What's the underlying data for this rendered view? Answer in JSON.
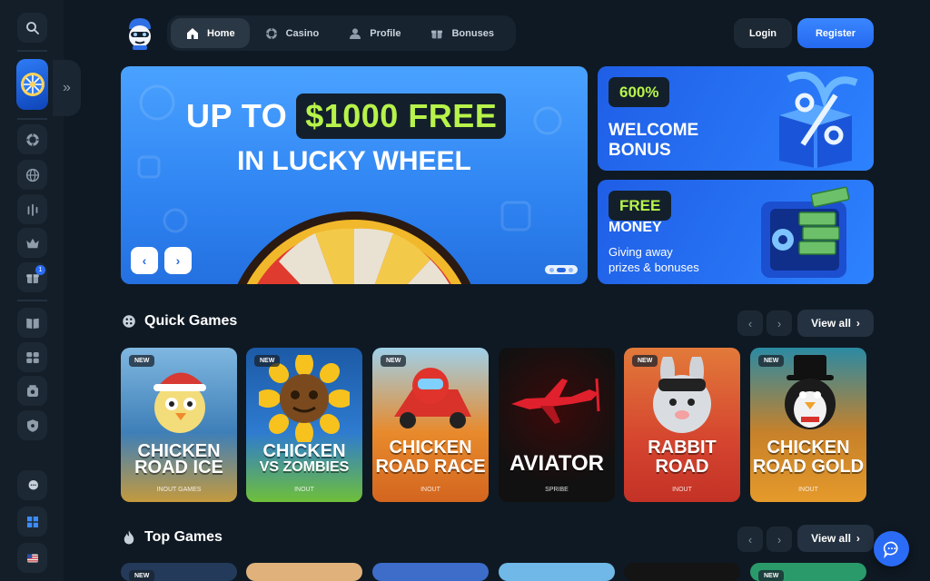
{
  "nav": {
    "items": [
      {
        "label": "Home",
        "icon": "home-icon",
        "active": true
      },
      {
        "label": "Casino",
        "icon": "chip-icon"
      },
      {
        "label": "Profile",
        "icon": "user-icon"
      },
      {
        "label": "Bonuses",
        "icon": "gift-icon"
      }
    ]
  },
  "auth": {
    "login": "Login",
    "register": "Register"
  },
  "hero": {
    "line1_prefix": "UP TO",
    "line1_highlight": "$1000 FREE",
    "line2": "IN LUCKY WHEEL",
    "prev": "‹",
    "next": "›"
  },
  "promo1": {
    "pill": "600%",
    "title1": "WELCOME",
    "title2": "BONUS"
  },
  "promo2": {
    "pill": "FREE",
    "title": "MONEY",
    "sub1": "Giving away",
    "sub2": "prizes & bonuses"
  },
  "quick_games": {
    "title": "Quick Games",
    "view_all": "View all",
    "games": [
      {
        "title1": "CHICKEN",
        "title2": "ROAD ICE",
        "provider": "INOUT GAMES",
        "badge": "NEW",
        "bg": "#4a8fc7"
      },
      {
        "title1": "CHICKEN",
        "title2": "VS ZOMBIES",
        "provider": "INOUT",
        "badge": "NEW",
        "bg": "#1d5fa8"
      },
      {
        "title1": "CHICKEN",
        "title2": "ROAD RACE",
        "provider": "INOUT",
        "badge": "NEW",
        "bg": "#e08a2e"
      },
      {
        "title1": "AVIATOR",
        "title2": "",
        "provider": "SPRIBE",
        "badge": "",
        "bg": "#1a1a1a"
      },
      {
        "title1": "RABBIT",
        "title2": "ROAD",
        "provider": "INOUT",
        "badge": "NEW",
        "bg": "#e25a3a"
      },
      {
        "title1": "CHICKEN",
        "title2": "ROAD GOLD",
        "provider": "INOUT",
        "badge": "NEW",
        "bg": "#d7952f"
      }
    ]
  },
  "top_games": {
    "title": "Top Games",
    "view_all": "View all",
    "badge1": "NEW",
    "badge6": "NEW"
  },
  "colors": {
    "accent": "#2b6cf6",
    "lime": "#b7f34a",
    "bg": "#0f1923"
  }
}
